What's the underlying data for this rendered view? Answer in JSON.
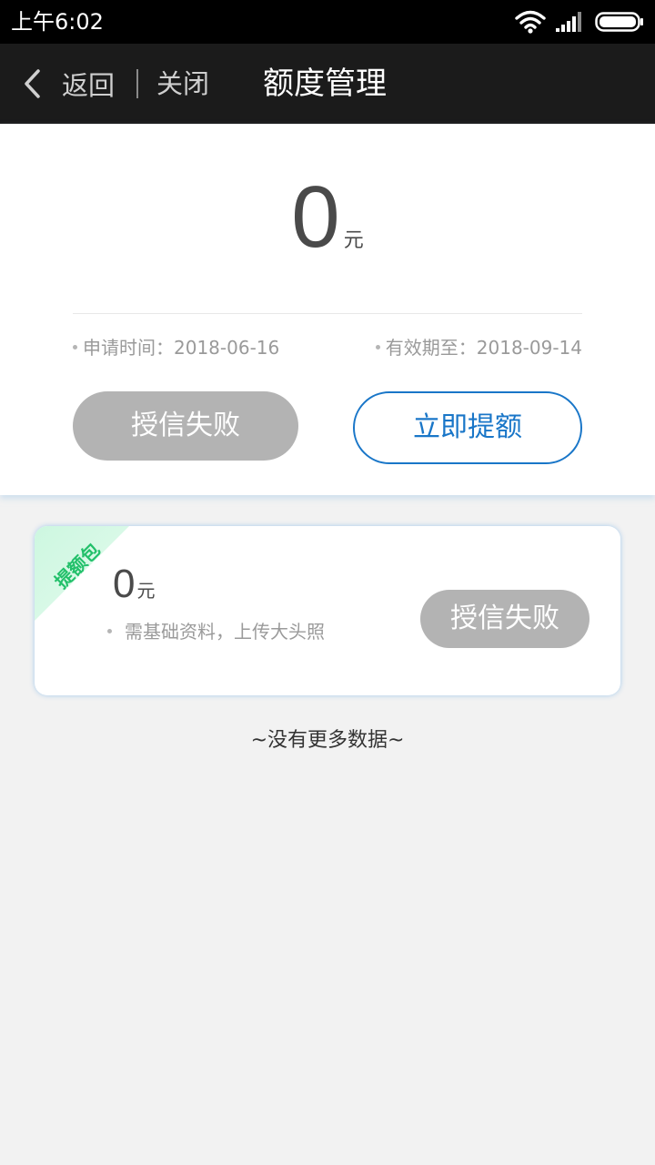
{
  "status_bar": {
    "time": "上午6:02"
  },
  "nav": {
    "back_label": "返回",
    "close_label": "关闭",
    "title": "额度管理"
  },
  "summary": {
    "amount": "0",
    "unit": "元",
    "apply_time": "申请时间：2018-06-16",
    "valid_until": "有效期至：2018-09-14",
    "status_button": "授信失败",
    "raise_button": "立即提额"
  },
  "package": {
    "ribbon": "提额包",
    "amount": "0",
    "unit": "元",
    "description": "需基础资料，上传大头照",
    "status_button": "授信失败"
  },
  "footer": {
    "no_more": "~没有更多数据~"
  },
  "colors": {
    "accent_blue": "#1976c8",
    "ribbon_green": "#22c06a",
    "disabled_gray": "#b3b3b3"
  }
}
